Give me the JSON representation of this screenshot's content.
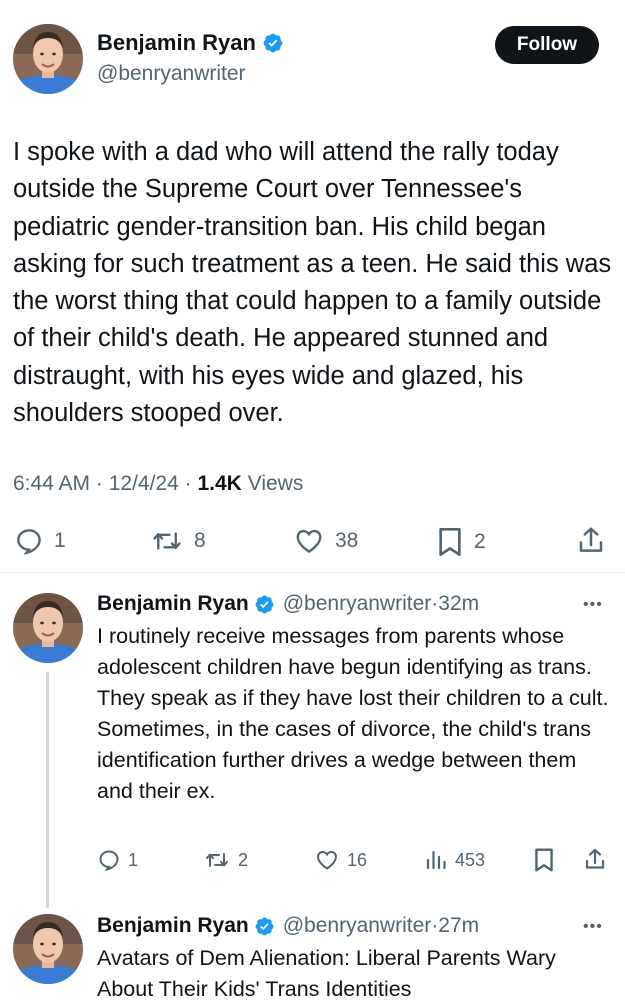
{
  "main_tweet": {
    "author_name": "Benjamin Ryan",
    "handle": "@benryanwriter",
    "follow_label": "Follow",
    "text": "I spoke with a dad who will attend the rally today outside the Supreme Court over Tennessee's pediatric gender-transition ban. His child began asking for such treatment as a teen. He said this was the worst thing that could happen to a family outside of their child's death. He appeared stunned and distraught, with his eyes wide and glazed, his shoulders stooped over.",
    "time": "6:44 AM",
    "date": "12/4/24",
    "views_count": "1.4K",
    "views_label": "Views",
    "replies": "1",
    "reposts": "8",
    "likes": "38",
    "bookmarks": "2"
  },
  "replies": [
    {
      "author_name": "Benjamin Ryan",
      "handle": "@benryanwriter",
      "age": "32m",
      "text": "I routinely receive messages from parents whose adolescent children have begun identifying as trans. They speak as if they have lost their children to a cult. Sometimes, in the cases of divorce, the child's trans identification further drives a wedge between them and their ex.",
      "replies": "1",
      "reposts": "2",
      "likes": "16",
      "views": "453"
    },
    {
      "author_name": "Benjamin Ryan",
      "handle": "@benryanwriter",
      "age": "27m",
      "text": "Avatars of Dem Alienation: Liberal Parents Wary About Their Kids' Trans Identities"
    }
  ],
  "colors": {
    "text_primary": "#0f1419",
    "text_secondary": "#536471",
    "verified_blue": "#1d9bf0",
    "thread_line": "#cfd9de"
  },
  "icons": [
    "verified-badge-icon",
    "reply-icon",
    "repost-icon",
    "like-icon",
    "bookmark-icon",
    "share-icon",
    "views-icon",
    "more-icon"
  ]
}
